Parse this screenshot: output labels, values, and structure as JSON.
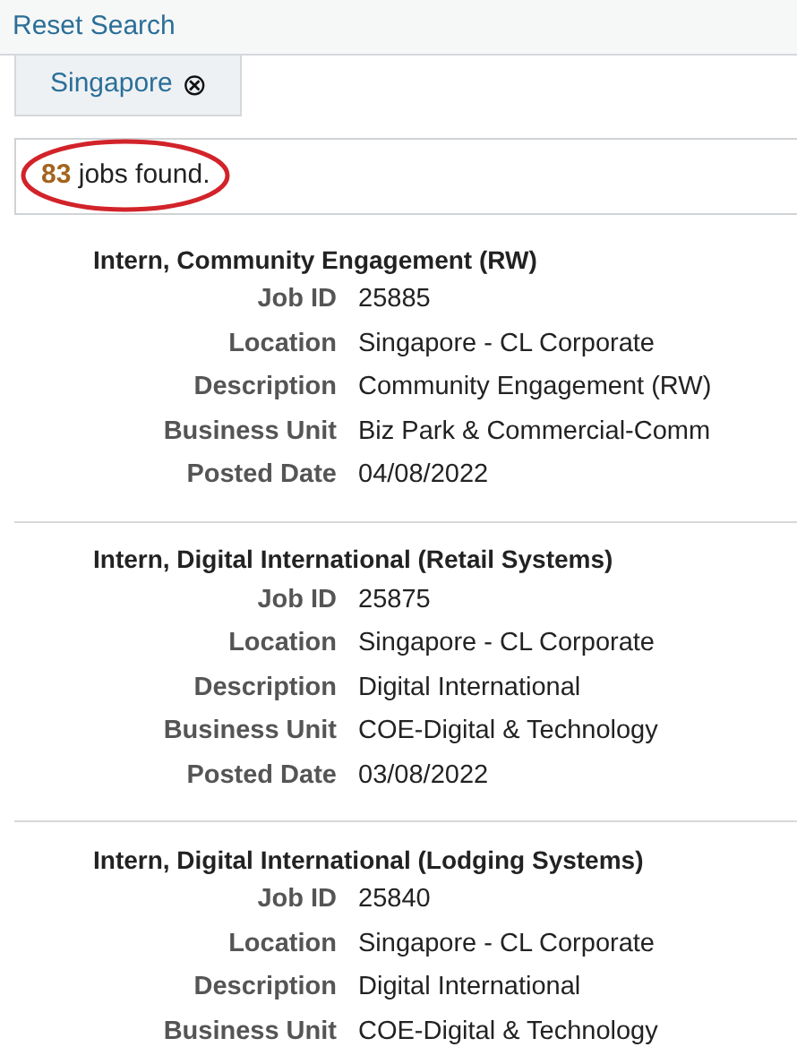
{
  "reset_link": "Reset Search",
  "filters": [
    {
      "label": "Singapore",
      "remove_icon": "⊗"
    }
  ],
  "results": {
    "count": "83",
    "text": "jobs found."
  },
  "jobs": [
    {
      "title": "Intern, Community Engagement (RW)",
      "fields": [
        {
          "label": "Job ID",
          "value": "25885"
        },
        {
          "label": "Location",
          "value": "Singapore - CL Corporate"
        },
        {
          "label": "Description",
          "value": "Community Engagement (RW)"
        },
        {
          "label": "Business Unit",
          "value": "Biz Park & Commercial-Comm"
        },
        {
          "label": "Posted Date",
          "value": "04/08/2022"
        }
      ]
    },
    {
      "title": "Intern, Digital International (Retail Systems)",
      "fields": [
        {
          "label": "Job ID",
          "value": "25875"
        },
        {
          "label": "Location",
          "value": "Singapore - CL Corporate"
        },
        {
          "label": "Description",
          "value": "Digital International"
        },
        {
          "label": "Business Unit",
          "value": "COE-Digital & Technology"
        },
        {
          "label": "Posted Date",
          "value": "03/08/2022"
        }
      ]
    },
    {
      "title": "Intern, Digital International (Lodging Systems)",
      "fields": [
        {
          "label": "Job ID",
          "value": "25840"
        },
        {
          "label": "Location",
          "value": "Singapore - CL Corporate"
        },
        {
          "label": "Description",
          "value": "Digital International"
        },
        {
          "label": "Business Unit",
          "value": "COE-Digital & Technology"
        }
      ]
    }
  ]
}
